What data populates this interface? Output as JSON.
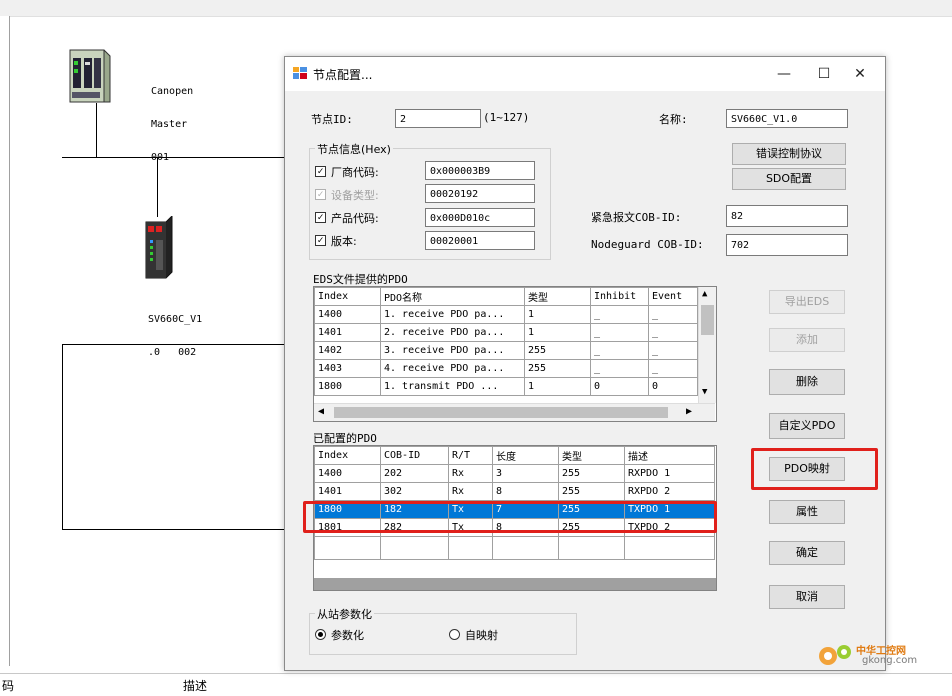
{
  "diagram": {
    "master": {
      "name": "Canopen",
      "role": "Master",
      "node": "001"
    },
    "slave": {
      "line1": "SV660C_V1",
      "line2": ".0   002"
    }
  },
  "bottom": {
    "col1": "码",
    "col2": "描述"
  },
  "dialog": {
    "title": "节点配置...",
    "window": {
      "minimize": "—",
      "maximize": "☐",
      "close": "✕"
    },
    "node_id_label": "节点ID:",
    "node_id_value": "2",
    "node_id_range": "(1~127)",
    "name_label": "名称:",
    "name_value": "SV660C_V1.0",
    "node_info": {
      "title": "节点信息(Hex)",
      "vendor_label": "厂商代码:",
      "vendor_value": "0x000003B9",
      "device_type_label": "设备类型:",
      "device_type_value": "00020192",
      "product_label": "产品代码:",
      "product_value": "0x000D010c",
      "version_label": "版本:",
      "version_value": "00020001"
    },
    "buttons": {
      "error_control": "错误控制协议",
      "sdo_config": "SDO配置",
      "export_eds": "导出EDS",
      "add": "添加",
      "delete": "删除",
      "custom_pdo": "自定义PDO",
      "pdo_mapping": "PDO映射",
      "properties": "属性",
      "ok": "确定",
      "cancel": "取消"
    },
    "emcy_label": "紧急报文COB-ID:",
    "emcy_value": "82",
    "nodeguard_label": "Nodeguard COB-ID:",
    "nodeguard_value": "702",
    "eds_pdo": {
      "title": "EDS文件提供的PDO",
      "headers": [
        "Index",
        "PDO名称",
        "类型",
        "Inhibit",
        "Event"
      ],
      "rows": [
        [
          "1400",
          "1. receive PDO pa...",
          "1",
          "_",
          "_"
        ],
        [
          "1401",
          "2. receive PDO pa...",
          "1",
          "_",
          "_"
        ],
        [
          "1402",
          "3. receive PDO pa...",
          "255",
          "_",
          "_"
        ],
        [
          "1403",
          "4. receive PDO pa...",
          "255",
          "_",
          "_"
        ],
        [
          "1800",
          "1. transmit PDO ...",
          "1",
          "0",
          "0"
        ]
      ]
    },
    "configured_pdo": {
      "title": "已配置的PDO",
      "headers": [
        "Index",
        "COB-ID",
        "R/T",
        "长度",
        "类型",
        "描述"
      ],
      "rows": [
        [
          "1400",
          "202",
          "Rx",
          "3",
          "255",
          "RXPDO  1"
        ],
        [
          "1401",
          "302",
          "Rx",
          "8",
          "255",
          "RXPDO  2"
        ],
        [
          "1800",
          "182",
          "Tx",
          "7",
          "255",
          "TXPDO  1"
        ],
        [
          "1801",
          "282",
          "Tx",
          "8",
          "255",
          "TXPDO  2"
        ]
      ],
      "selected_row": 2
    },
    "slave_param": {
      "title": "从站参数化",
      "opt1": "参数化",
      "opt2": "自映射",
      "selected": "opt1"
    }
  },
  "watermark": {
    "text1": "中华工控网",
    "text2": "gkong.com"
  },
  "colors": {
    "selection": "#0078d7",
    "highlight_box": "#e0201b"
  }
}
